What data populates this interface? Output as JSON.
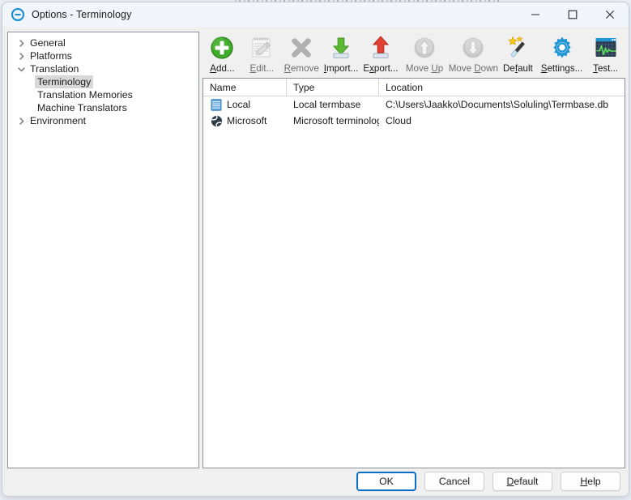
{
  "window": {
    "title": "Options - Terminology",
    "app_icon": "options-circle-icon",
    "controls": {
      "minimize": "minimize-icon",
      "maximize": "maximize-icon",
      "close": "close-icon"
    }
  },
  "sidebar": {
    "items": [
      {
        "label": "General",
        "level": 0,
        "expander": "collapsed",
        "selected": false
      },
      {
        "label": "Platforms",
        "level": 0,
        "expander": "collapsed",
        "selected": false
      },
      {
        "label": "Translation",
        "level": 0,
        "expander": "expanded",
        "selected": false
      },
      {
        "label": "Terminology",
        "level": 1,
        "expander": "none",
        "selected": true
      },
      {
        "label": "Translation Memories",
        "level": 1,
        "expander": "none",
        "selected": false
      },
      {
        "label": "Machine Translators",
        "level": 1,
        "expander": "none",
        "selected": false
      },
      {
        "label": "Environment",
        "level": 0,
        "expander": "collapsed",
        "selected": false
      }
    ]
  },
  "toolbar": {
    "items": [
      {
        "label": "Add...",
        "accel": "A",
        "icon": "add-plus-icon",
        "enabled": true,
        "wide": false
      },
      {
        "label": "Edit...",
        "accel": "E",
        "icon": "edit-pencil-icon",
        "enabled": false,
        "wide": false
      },
      {
        "label": "Remove",
        "accel": "R",
        "icon": "remove-cross-icon",
        "enabled": false,
        "wide": false
      },
      {
        "label": "Import...",
        "accel": "I",
        "icon": "import-down-arrow-icon",
        "enabled": true,
        "wide": false
      },
      {
        "label": "Export...",
        "accel": "x",
        "icon": "export-up-arrow-icon",
        "enabled": true,
        "wide": false
      },
      {
        "label": "Move Up",
        "accel": "U",
        "icon": "move-up-icon",
        "enabled": false,
        "wide": true
      },
      {
        "label": "Move Down",
        "accel": "D",
        "icon": "move-down-icon",
        "enabled": false,
        "wide": true
      },
      {
        "label": "Default",
        "accel": "f",
        "icon": "magic-wand-icon",
        "enabled": true,
        "wide": false
      },
      {
        "label": "Settings...",
        "accel": "S",
        "icon": "gear-icon",
        "enabled": true,
        "wide": true
      },
      {
        "label": "Test...",
        "accel": "T",
        "icon": "test-monitor-icon",
        "enabled": true,
        "wide": false
      }
    ]
  },
  "list": {
    "columns": [
      "Name",
      "Type",
      "Location"
    ],
    "rows": [
      {
        "icon": "termbase-database-icon",
        "name": "Local",
        "type": "Local termbase",
        "location": "C:\\Users\\Jaakko\\Documents\\Soluling\\Termbase.db"
      },
      {
        "icon": "globe-cloud-icon",
        "name": "Microsoft",
        "type": "Microsoft terminology",
        "location": "Cloud"
      }
    ]
  },
  "footer": {
    "buttons": [
      {
        "label": "OK",
        "accel": "",
        "default": true
      },
      {
        "label": "Cancel",
        "accel": "",
        "default": false
      },
      {
        "label": "Default",
        "accel": "D",
        "default": false
      },
      {
        "label": "Help",
        "accel": "H",
        "default": false
      }
    ]
  },
  "colors": {
    "titlebar": "#f2f5fb",
    "dialog": "#f0f0f0",
    "accent": "#0b6ec6",
    "add_green": "#3aa527",
    "export_red": "#e0392b",
    "selection": "#d8d8d8"
  }
}
